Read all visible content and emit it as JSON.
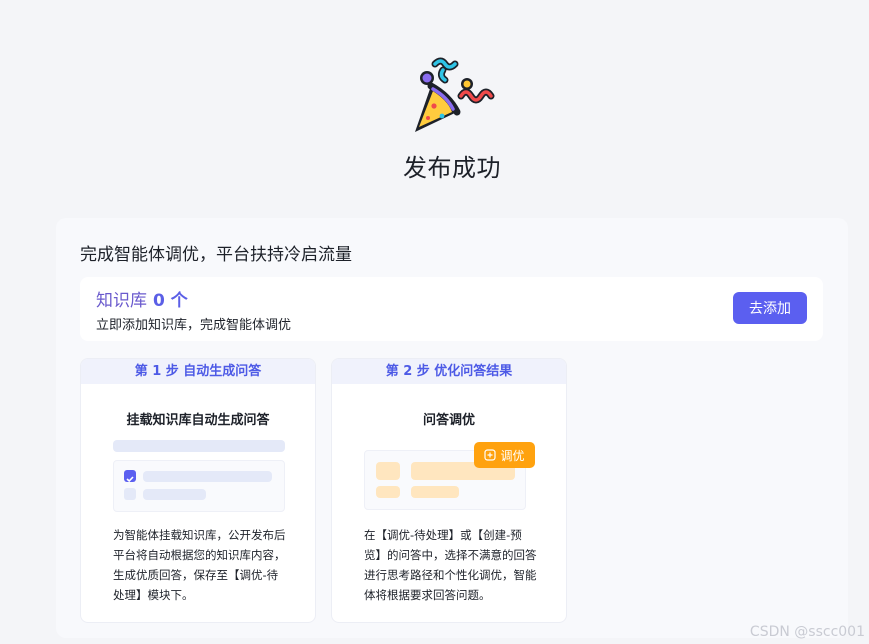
{
  "hero": {
    "title": "发布成功",
    "icon": "party-popper-icon"
  },
  "panel": {
    "title": "完成智能体调优，平台扶持冷启流量",
    "knowledge_base": {
      "label": "知识库",
      "count": "0 个",
      "description": "立即添加知识库，完成智能体调优",
      "add_button": "去添加"
    },
    "steps": [
      {
        "header": "第 1 步 自动生成问答",
        "heading": "挂载知识库自动生成问答",
        "description": "为智能体挂载知识库，公开发布后平台将自动根据您的知识库内容，生成优质回答，保存至【调优-待处理】模块下。"
      },
      {
        "header": "第 2 步 优化问答结果",
        "heading": "问答调优",
        "badge": "调优",
        "description": "在【调优-待处理】或【创建-预览】的问答中，选择不满意的回答进行思考路径和个性化调优，智能体将根据要求回答问题。"
      }
    ]
  },
  "watermark": "CSDN @sscc001",
  "colors": {
    "accent": "#5b5ff0",
    "badge": "#ffa20f",
    "step_header_text": "#4d5ae6"
  }
}
